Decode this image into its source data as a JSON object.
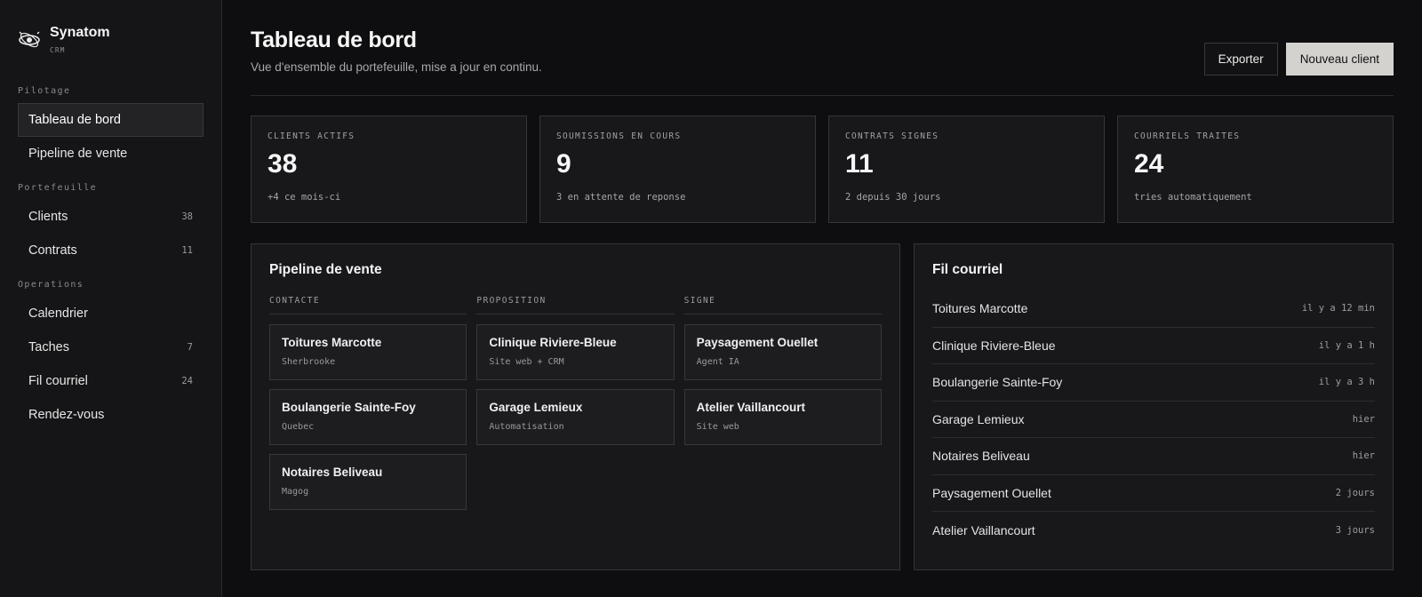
{
  "brand": {
    "name": "Synatom",
    "sub": "CRM",
    "logo_icon": "eye-atom-icon"
  },
  "sidebar": {
    "sections": [
      {
        "title": "Pilotage",
        "items": [
          {
            "label": "Tableau de bord",
            "count": "",
            "active": true
          },
          {
            "label": "Pipeline de vente",
            "count": ""
          }
        ]
      },
      {
        "title": "Portefeuille",
        "items": [
          {
            "label": "Clients",
            "count": "38"
          },
          {
            "label": "Contrats",
            "count": "11"
          }
        ]
      },
      {
        "title": "Operations",
        "items": [
          {
            "label": "Calendrier",
            "count": ""
          },
          {
            "label": "Taches",
            "count": "7"
          },
          {
            "label": "Fil courriel",
            "count": "24"
          },
          {
            "label": "Rendez-vous",
            "count": ""
          }
        ]
      }
    ]
  },
  "header": {
    "title": "Tableau de bord",
    "subtitle": "Vue d'ensemble du portefeuille, mise a jour en continu.",
    "export_label": "Exporter",
    "new_client_label": "Nouveau client"
  },
  "stats": [
    {
      "label": "CLIENTS ACTIFS",
      "value": "38",
      "note": "+4 ce mois-ci"
    },
    {
      "label": "SOUMISSIONS EN COURS",
      "value": "9",
      "note": "3 en attente de reponse"
    },
    {
      "label": "CONTRATS SIGNES",
      "value": "11",
      "note": "2 depuis 30 jours"
    },
    {
      "label": "COURRIELS TRAITES",
      "value": "24",
      "note": "tries automatiquement"
    }
  ],
  "pipeline": {
    "title": "Pipeline de vente",
    "columns": [
      {
        "title": "CONTACTE",
        "cards": [
          {
            "name": "Toitures Marcotte",
            "sub": "Sherbrooke"
          },
          {
            "name": "Boulangerie Sainte-Foy",
            "sub": "Quebec"
          },
          {
            "name": "Notaires Beliveau",
            "sub": "Magog"
          }
        ]
      },
      {
        "title": "PROPOSITION",
        "cards": [
          {
            "name": "Clinique Riviere-Bleue",
            "sub": "Site web + CRM"
          },
          {
            "name": "Garage Lemieux",
            "sub": "Automatisation"
          }
        ]
      },
      {
        "title": "SIGNE",
        "cards": [
          {
            "name": "Paysagement Ouellet",
            "sub": "Agent IA"
          },
          {
            "name": "Atelier Vaillancourt",
            "sub": "Site web"
          }
        ]
      }
    ]
  },
  "feed": {
    "title": "Fil courriel",
    "items": [
      {
        "name": "Toitures Marcotte",
        "time": "il y a 12 min"
      },
      {
        "name": "Clinique Riviere-Bleue",
        "time": "il y a 1 h"
      },
      {
        "name": "Boulangerie Sainte-Foy",
        "time": "il y a 3 h"
      },
      {
        "name": "Garage Lemieux",
        "time": "hier"
      },
      {
        "name": "Notaires Beliveau",
        "time": "hier"
      },
      {
        "name": "Paysagement Ouellet",
        "time": "2 jours"
      },
      {
        "name": "Atelier Vaillancourt",
        "time": "3 jours"
      }
    ]
  }
}
